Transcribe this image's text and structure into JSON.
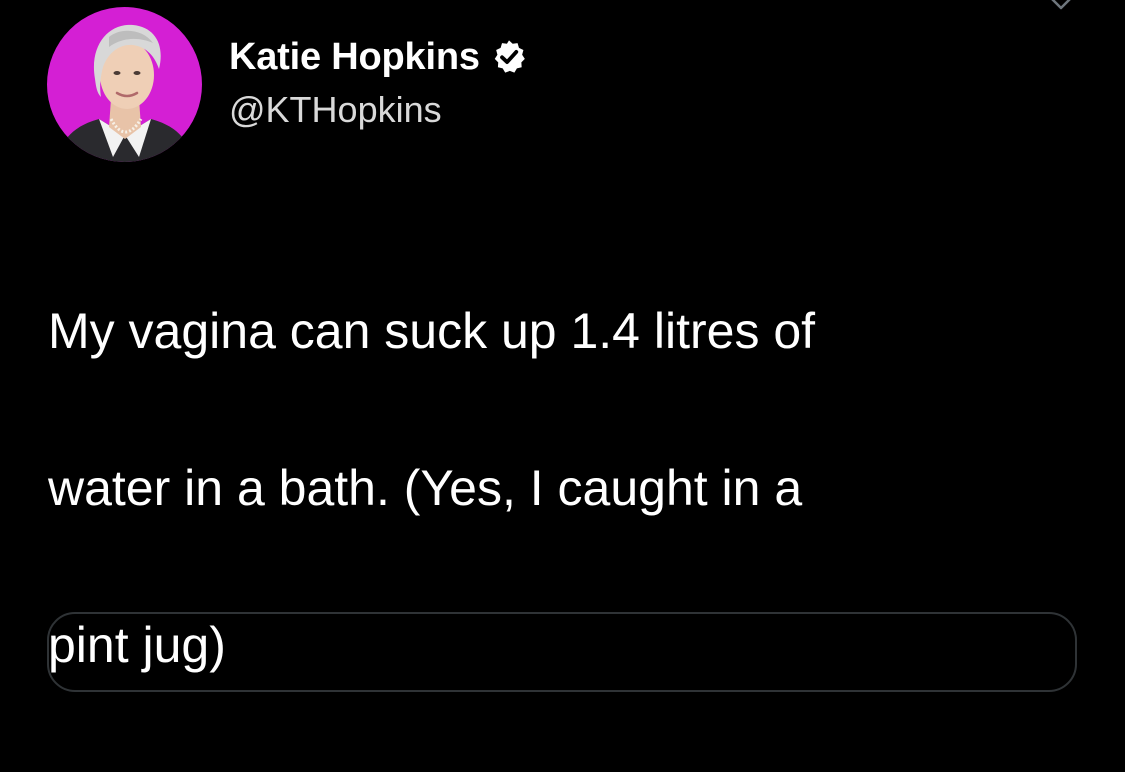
{
  "tweet": {
    "author": {
      "display_name": "Katie Hopkins",
      "handle": "@KTHopkins",
      "verified": true,
      "avatar_icon": "profile-photo",
      "avatar_background": "#d41fd4"
    },
    "text_lines": [
      "My vagina can suck up 1.4 litres of",
      "water in a bath. (Yes, I caught in a",
      "pint jug)"
    ],
    "menu_icon": "chevron-down-icon",
    "verified_icon": "verified-badge-icon"
  },
  "theme": {
    "background": "#000000",
    "text": "#ffffff",
    "secondary_text": "#d9d9d9",
    "border": "#2f3336"
  }
}
